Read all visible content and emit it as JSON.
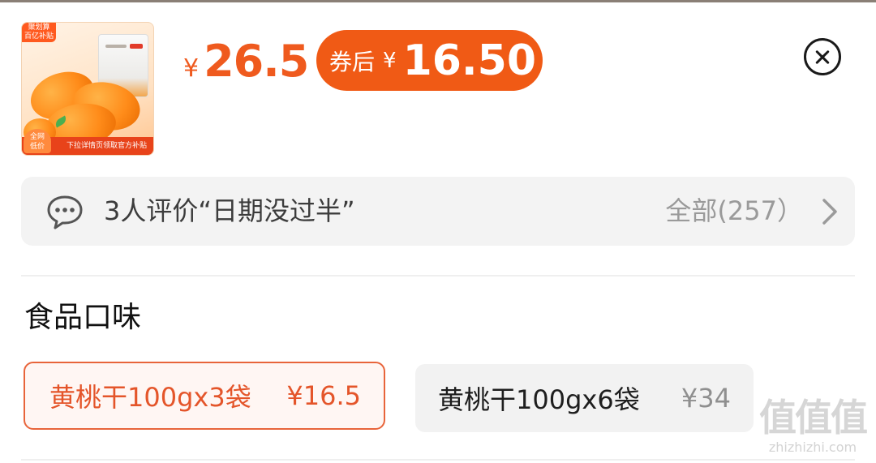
{
  "product": {
    "thumbnail": {
      "badge_top": "聚划算\n百亿补贴",
      "bag_label": "黄桃干",
      "bottom_tag": "全网\n低价",
      "bottom_strip": "下拉详情页领取官方补贴"
    },
    "price": {
      "currency": "¥",
      "original": "26.5"
    },
    "coupon": {
      "label": "券后",
      "currency": "¥",
      "price": "16.50"
    }
  },
  "close": {
    "icon": "close-circle-icon"
  },
  "review": {
    "icon": "chat-bubble-icon",
    "summary": "3人评价“日期没过半”",
    "all_label": "全部(257）",
    "chevron_icon": "chevron-right-icon"
  },
  "spec": {
    "title": "食品口味",
    "options": [
      {
        "label": "黄桃干100gx3袋",
        "price": "¥16.5",
        "selected": true
      },
      {
        "label": "黄桃干100gx6袋",
        "price": "¥34",
        "selected": false
      }
    ]
  },
  "watermark": {
    "logo": "值值值",
    "url": "zhizhizhi.com"
  },
  "colors": {
    "accent": "#ef5a1e",
    "coupon_bg": "#f05a15",
    "review_bg": "#f3f3f3",
    "selected_border": "#e8643a"
  }
}
